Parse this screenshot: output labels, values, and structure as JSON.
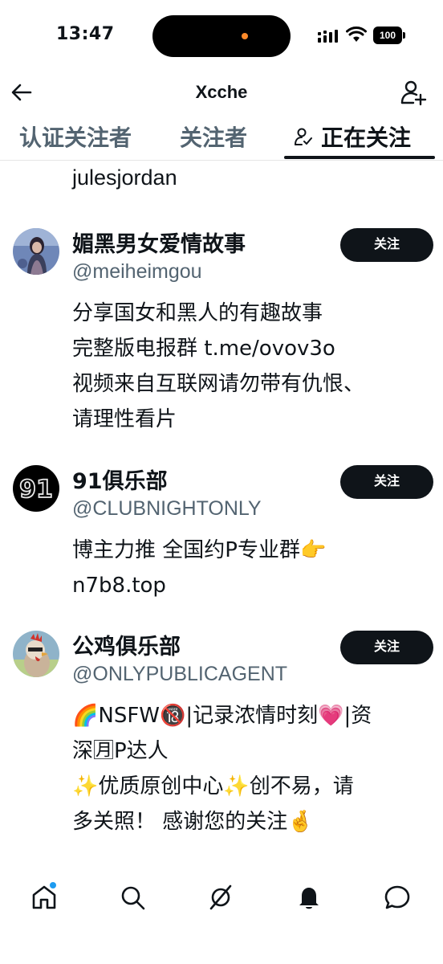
{
  "status_bar": {
    "time": "13:47",
    "battery": "100"
  },
  "header": {
    "title": "Xcche"
  },
  "tabs": [
    {
      "label": "认证关注者",
      "active": false
    },
    {
      "label": "关注者",
      "active": false
    },
    {
      "label": "正在关注",
      "active": true
    }
  ],
  "partial_row": {
    "text": "julesjordan"
  },
  "users": [
    {
      "name": "媚黑男女爱情故事",
      "handle": "@meiheimgou",
      "bio": [
        "分享国女和黑人的有趣故事",
        "完整版电报群 t.me/ovov3o",
        "视频来自互联网请勿带有仇恨、",
        "请理性看片"
      ],
      "follow_label": "关注"
    },
    {
      "name": "91俱乐部",
      "handle": "@CLUBNIGHTONLY",
      "bio": [
        "博主力推 全国约P专业群👉",
        "n7b8.top"
      ],
      "follow_label": "关注"
    },
    {
      "name": "公鸡俱乐部",
      "handle": "@ONLYPUBLICAGENT",
      "bio": [
        "🌈NSFW🔞|记录浓情时刻💗|资",
        "深🈷P达人",
        "✨优质原创中心✨创不易，请",
        "多关照！ 感谢您的关注🤞"
      ],
      "follow_label": "关注"
    }
  ],
  "nav": [
    "home-icon",
    "search-icon",
    "grok-icon",
    "notifications-icon",
    "messages-icon"
  ]
}
